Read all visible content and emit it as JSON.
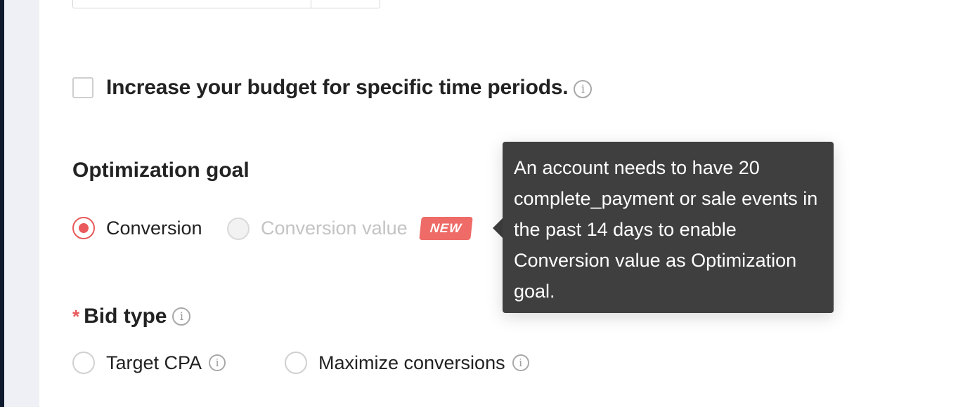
{
  "budget_schedule": {
    "checkbox_label": "Increase your budget for specific time periods."
  },
  "optimization_goal": {
    "title": "Optimization goal",
    "options": [
      {
        "label": "Conversion",
        "selected": true,
        "disabled": false
      },
      {
        "label": "Conversion value",
        "selected": false,
        "disabled": true
      }
    ],
    "new_badge": "NEW"
  },
  "tooltip": {
    "text": "An account needs to have 20 complete_payment or sale events in the past 14 days to enable Conversion value as Optimization goal."
  },
  "bid_type": {
    "required_mark": "*",
    "title": "Bid type",
    "options": [
      {
        "label": "Target CPA",
        "selected": false
      },
      {
        "label": "Maximize conversions",
        "selected": false
      }
    ]
  },
  "icons": {
    "info": "info-icon"
  },
  "colors": {
    "accent": "#ea5a5c",
    "badge": "#ee6b67",
    "tooltip_bg": "#3f3f3f",
    "sidebar_dark": "#0f1a2e",
    "sidebar_light": "#eef0f5"
  }
}
